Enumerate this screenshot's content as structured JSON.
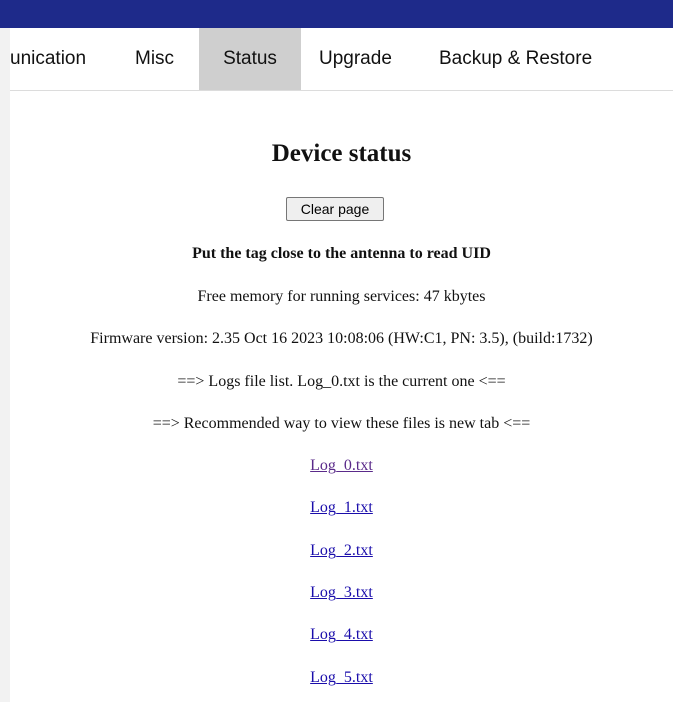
{
  "nav": {
    "tabs": [
      {
        "label": "unication"
      },
      {
        "label": "Misc"
      },
      {
        "label": "Status",
        "active": true
      },
      {
        "label": "Upgrade"
      },
      {
        "label": "Backup & Restore"
      }
    ]
  },
  "status": {
    "title": "Device status",
    "clear_button": "Clear page",
    "uid_prompt": "Put the tag close to the antenna to read UID",
    "free_memory": "Free memory for running services: 47 kbytes",
    "firmware": "Firmware version: 2.35 Oct 16 2023 10:08:06 (HW:C1, PN: 3.5), (build:1732)",
    "logs_note": "==> Logs file list. Log_0.txt is the current one <==",
    "view_note": "==> Recommended way to view these files is new tab <==",
    "log_files": [
      "Log_0.txt",
      "Log_1.txt",
      "Log_2.txt",
      "Log_3.txt",
      "Log_4.txt",
      "Log_5.txt"
    ]
  },
  "colors": {
    "header_bar": "#1e2a8a",
    "active_tab": "#cfcfcf",
    "link": "#1a0dab",
    "visited_link": "#5a2a8a"
  }
}
